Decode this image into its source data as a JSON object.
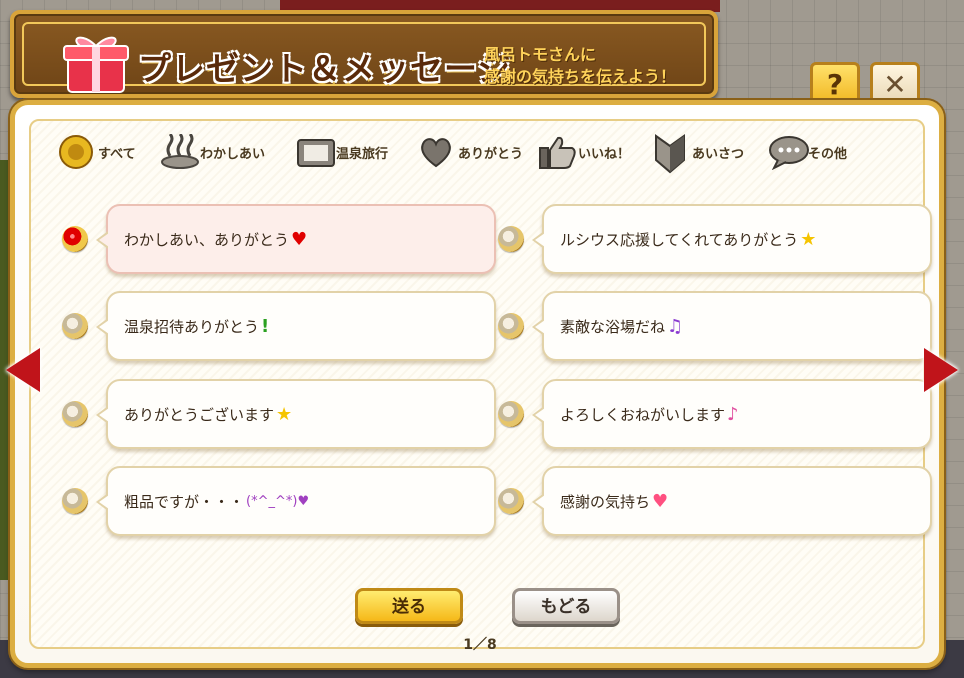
{
  "header": {
    "title": "プレゼント＆メッセージ",
    "subtitle_line1": "風呂トモさんに",
    "subtitle_line2": "感謝の気持ちを伝えよう！"
  },
  "controls": {
    "help_label": "?",
    "close_label": "✕"
  },
  "tabs": [
    {
      "label": "すべて",
      "icon": "all-icon",
      "selected": true
    },
    {
      "label": "わかしあい",
      "icon": "hot-spring-icon",
      "selected": false
    },
    {
      "label": "温泉旅行",
      "icon": "travel-ticket-icon",
      "selected": false
    },
    {
      "label": "ありがとう",
      "icon": "heart-icon",
      "selected": false
    },
    {
      "label": "いいね！",
      "icon": "thumbs-up-icon",
      "selected": false
    },
    {
      "label": "あいさつ",
      "icon": "beginner-mark-icon",
      "selected": false
    },
    {
      "label": "その他",
      "icon": "speech-bubble-icon",
      "selected": false
    }
  ],
  "messages": [
    {
      "text": "わかしあい、ありがとう",
      "emoji": "♥",
      "emoji_color": "#e00000",
      "selected": true
    },
    {
      "text": "ルシウス応援してくれてありがとう",
      "emoji": "★",
      "emoji_color": "#f5c400",
      "selected": false
    },
    {
      "text": "温泉招待ありがとう",
      "emoji": "!",
      "emoji_color": "#2aa020",
      "selected": false
    },
    {
      "text": "素敵な浴場だね",
      "emoji": "♫",
      "emoji_color": "#8a3ad0",
      "selected": false
    },
    {
      "text": "ありがとうございます",
      "emoji": "★",
      "emoji_color": "#f5c400",
      "selected": false
    },
    {
      "text": "よろしくおねがいします",
      "emoji": "♪",
      "emoji_color": "#e050a0",
      "selected": false
    },
    {
      "text": "粗品ですが・・・",
      "emoji": "(*^_^*)♥",
      "emoji_color": "#a040c0",
      "selected": false
    },
    {
      "text": "感謝の気持ち",
      "emoji": "♥",
      "emoji_color": "#ff5080",
      "selected": false
    }
  ],
  "buttons": {
    "send": "送る",
    "back": "もどる"
  },
  "pagination": "1／8",
  "colors": {
    "accent_red": "#c0141a",
    "frame_gold": "#dcae42"
  }
}
